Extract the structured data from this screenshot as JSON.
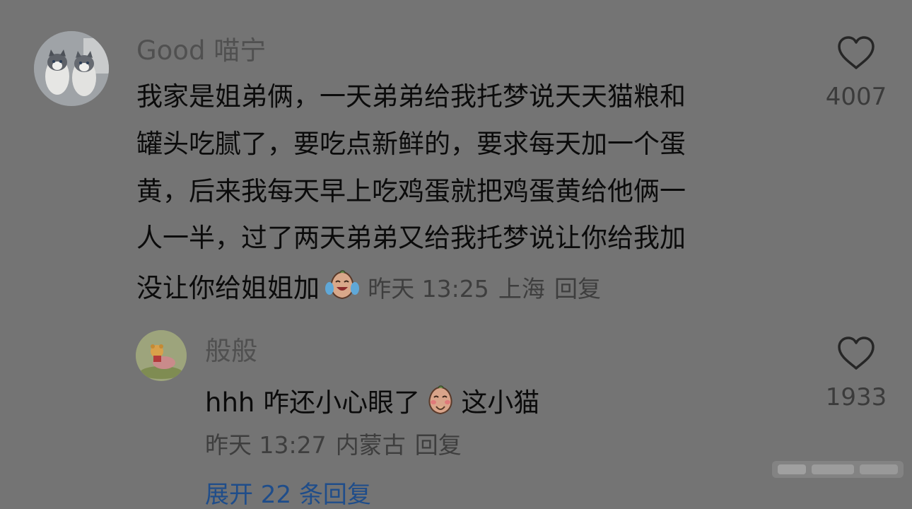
{
  "comment": {
    "username": "Good 喵宁",
    "lines": [
      "我家是姐弟俩，一天弟弟给我托梦说天天猫粮和",
      "罐头吃腻了，要吃点新鲜的，要求每天加一个蛋",
      "黄，后来我每天早上吃鸡蛋就把鸡蛋黄给他俩一",
      "人一半，过了两天弟弟又给我托梦说让你给我加"
    ],
    "last_line": "没让你给姐姐加",
    "emoji": "crying-laughing-emoji",
    "time": "昨天 13:25",
    "location": "上海",
    "reply_label": "回复",
    "like_count": "4007"
  },
  "reply": {
    "username": "般般",
    "text_before": "hhh 咋还小心眼了",
    "emoji": "giggle-emoji",
    "text_after": "这小猫",
    "time": "昨天 13:27",
    "location": "内蒙古",
    "reply_label": "回复",
    "like_count": "1933"
  },
  "expand_label": "展开 22 条回复",
  "colors": {
    "background": "#747474",
    "text": "#0b0b0b",
    "meta": "#3e3e3e",
    "link": "#1f4d8a"
  }
}
